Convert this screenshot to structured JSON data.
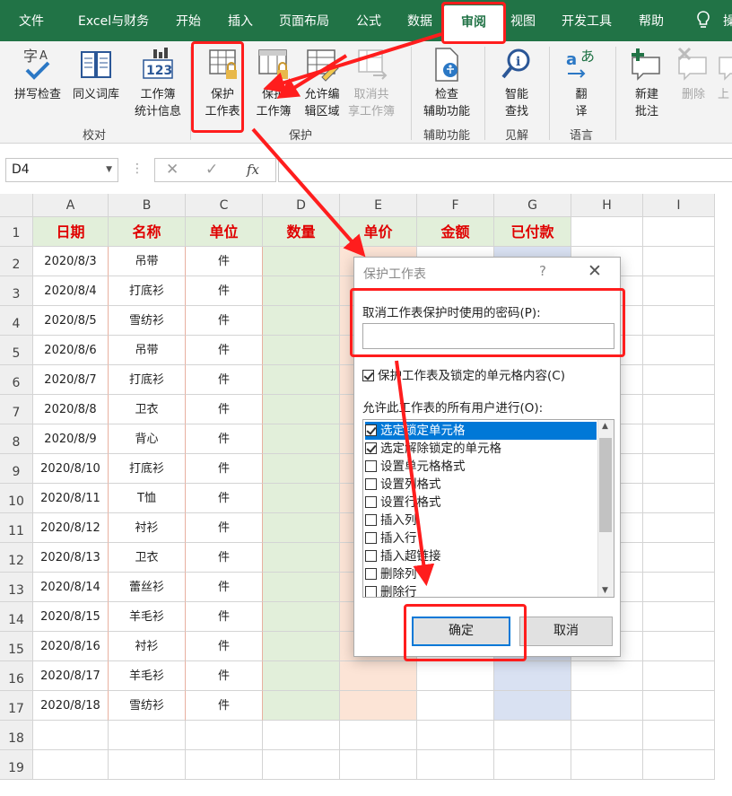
{
  "menu": {
    "items": [
      "文件",
      "Excel与财务",
      "开始",
      "插入",
      "页面布局",
      "公式",
      "数据",
      "审阅",
      "视图",
      "开发工具",
      "帮助",
      "操"
    ],
    "active": "审阅",
    "lightbulb": "lightbulb-icon"
  },
  "ribbon": {
    "buttons": {
      "spell": "拼写检查",
      "thesaurus": "同义词库",
      "stats1": "工作簿",
      "stats2": "统计信息",
      "protect_sheet1": "保护",
      "protect_sheet2": "工作表",
      "protect_wb1": "保护",
      "protect_wb2": "工作簿",
      "allow_edit1": "允许编",
      "allow_edit2": "辑区域",
      "unshare1": "取消共",
      "unshare2": "享工作簿",
      "access1": "检查",
      "access2": "辅助功能",
      "lookup1": "智能",
      "lookup2": "查找",
      "translate1": "翻",
      "translate2": "译",
      "new_comment1": "新建",
      "new_comment2": "批注",
      "delete_comment": "删除",
      "prev_comment": "上"
    },
    "groups": {
      "proofing": "校对",
      "protect": "保护",
      "accessibility": "辅助功能",
      "insights": "见解",
      "language": "语言"
    }
  },
  "formula_bar": {
    "name_box": "D4",
    "fx": "fx"
  },
  "sheet": {
    "columns": [
      "A",
      "B",
      "C",
      "D",
      "E",
      "F",
      "G",
      "H",
      "I"
    ],
    "rows": [
      "1",
      "2",
      "3",
      "4",
      "5",
      "6",
      "7",
      "8",
      "9",
      "10",
      "11",
      "12",
      "13",
      "14",
      "15",
      "16",
      "17",
      "18",
      "19"
    ],
    "headers": [
      "日期",
      "名称",
      "单位",
      "数量",
      "单价",
      "金额",
      "已付款"
    ],
    "data": [
      [
        "2020/8/3",
        "吊带",
        "件"
      ],
      [
        "2020/8/4",
        "打底衫",
        "件"
      ],
      [
        "2020/8/5",
        "雪纺衫",
        "件"
      ],
      [
        "2020/8/6",
        "吊带",
        "件"
      ],
      [
        "2020/8/7",
        "打底衫",
        "件"
      ],
      [
        "2020/8/8",
        "卫衣",
        "件"
      ],
      [
        "2020/8/9",
        "背心",
        "件"
      ],
      [
        "2020/8/10",
        "打底衫",
        "件"
      ],
      [
        "2020/8/11",
        "T恤",
        "件"
      ],
      [
        "2020/8/12",
        "衬衫",
        "件"
      ],
      [
        "2020/8/13",
        "卫衣",
        "件"
      ],
      [
        "2020/8/14",
        "蕾丝衫",
        "件"
      ],
      [
        "2020/8/15",
        "羊毛衫",
        "件"
      ],
      [
        "2020/8/16",
        "衬衫",
        "件"
      ],
      [
        "2020/8/17",
        "羊毛衫",
        "件"
      ],
      [
        "2020/8/18",
        "雪纺衫",
        "件"
      ]
    ],
    "colors": {
      "header_bg": "#e2efda",
      "d_fill": "#e2efda",
      "e_fill": "#fce4d6",
      "g_fill": "#d9e1f2",
      "header_text": "#e00000"
    }
  },
  "dialog": {
    "title": "保护工作表",
    "help": "?",
    "close": "✕",
    "password_label": "取消工作表保护时使用的密码(P):",
    "password_value": "",
    "protect_label": "保护工作表及锁定的单元格内容(C)",
    "protect_checked": true,
    "allow_label": "允许此工作表的所有用户进行(O):",
    "options": [
      {
        "label": "选定锁定单元格",
        "checked": true,
        "selected": true
      },
      {
        "label": "选定解除锁定的单元格",
        "checked": true,
        "selected": false
      },
      {
        "label": "设置单元格格式",
        "checked": false,
        "selected": false
      },
      {
        "label": "设置列格式",
        "checked": false,
        "selected": false
      },
      {
        "label": "设置行格式",
        "checked": false,
        "selected": false
      },
      {
        "label": "插入列",
        "checked": false,
        "selected": false
      },
      {
        "label": "插入行",
        "checked": false,
        "selected": false
      },
      {
        "label": "插入超链接",
        "checked": false,
        "selected": false
      },
      {
        "label": "删除列",
        "checked": false,
        "selected": false
      },
      {
        "label": "删除行",
        "checked": false,
        "selected": false
      }
    ],
    "ok": "确定",
    "cancel": "取消"
  },
  "accent": "#217346",
  "annotation_color": "#ff1d1d"
}
